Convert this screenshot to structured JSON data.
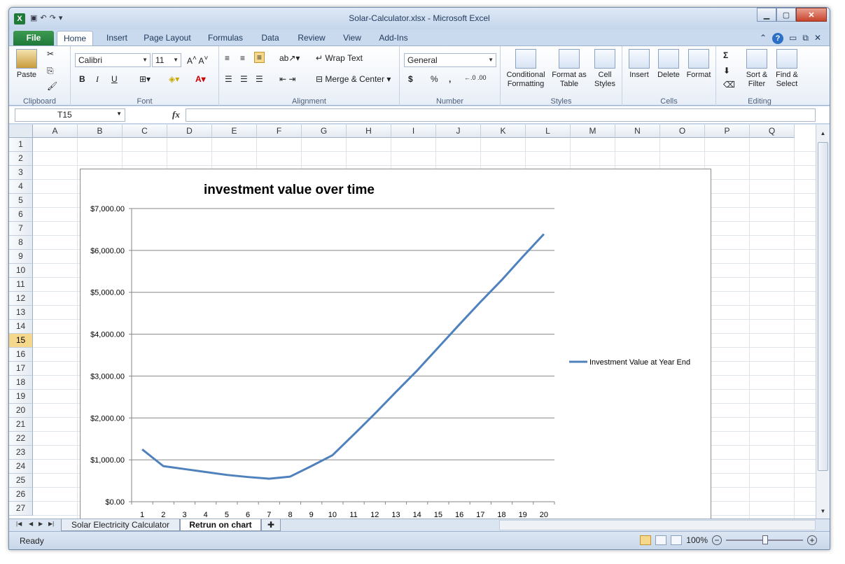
{
  "window": {
    "title": "Solar-Calculator.xlsx - Microsoft Excel",
    "app_icon": "X"
  },
  "tabs": [
    "File",
    "Home",
    "Insert",
    "Page Layout",
    "Formulas",
    "Data",
    "Review",
    "View",
    "Add-Ins"
  ],
  "ribbon": {
    "clipboard": {
      "label": "Clipboard",
      "paste": "Paste"
    },
    "font": {
      "label": "Font",
      "name": "Calibri",
      "size": "11",
      "bold": "B",
      "italic": "I",
      "underline": "U"
    },
    "alignment": {
      "label": "Alignment",
      "wrap": "Wrap Text",
      "merge": "Merge & Center"
    },
    "number": {
      "label": "Number",
      "format": "General",
      "currency": "$",
      "percent": "%",
      "comma": ","
    },
    "styles": {
      "label": "Styles",
      "conditional": "Conditional Formatting",
      "format_table": "Format as Table",
      "cell_styles": "Cell Styles"
    },
    "cells": {
      "label": "Cells",
      "insert": "Insert",
      "delete": "Delete",
      "format": "Format"
    },
    "editing": {
      "label": "Editing",
      "sort": "Sort & Filter",
      "find": "Find & Select",
      "sigma": "Σ"
    }
  },
  "formula_bar": {
    "cell": "T15",
    "fx": "fx",
    "value": ""
  },
  "columns": [
    "A",
    "B",
    "C",
    "D",
    "E",
    "F",
    "G",
    "H",
    "I",
    "J",
    "K",
    "L",
    "M",
    "N",
    "O",
    "P",
    "Q"
  ],
  "rows": [
    "1",
    "2",
    "3",
    "4",
    "5",
    "6",
    "7",
    "8",
    "9",
    "10",
    "11",
    "12",
    "13",
    "14",
    "15",
    "16",
    "17",
    "18",
    "19",
    "20",
    "21",
    "22",
    "23",
    "24",
    "25",
    "26",
    "27"
  ],
  "selected_row": "15",
  "sheets": [
    "Solar Electricity Calculator",
    "Retrun on chart"
  ],
  "active_sheet": "Retrun on chart",
  "status": {
    "text": "Ready",
    "zoom": "100%"
  },
  "chart_data": {
    "type": "line",
    "title": "investment value over time",
    "xlabel": "",
    "ylabel": "",
    "x": [
      1,
      2,
      3,
      4,
      5,
      6,
      7,
      8,
      9,
      10,
      11,
      12,
      13,
      14,
      15,
      16,
      17,
      18,
      19,
      20
    ],
    "series": [
      {
        "name": "Investment Value at Year End",
        "values": [
          1250,
          850,
          780,
          710,
          640,
          590,
          550,
          600,
          850,
          1110,
          1600,
          2100,
          2620,
          3130,
          3680,
          4230,
          4770,
          5290,
          5850,
          6390
        ],
        "color": "#4f81bd"
      }
    ],
    "ylim": [
      0,
      7000
    ],
    "yticks": [
      "$0.00",
      "$1,000.00",
      "$2,000.00",
      "$3,000.00",
      "$4,000.00",
      "$5,000.00",
      "$6,000.00",
      "$7,000.00"
    ],
    "grid": true,
    "legend": "right"
  }
}
